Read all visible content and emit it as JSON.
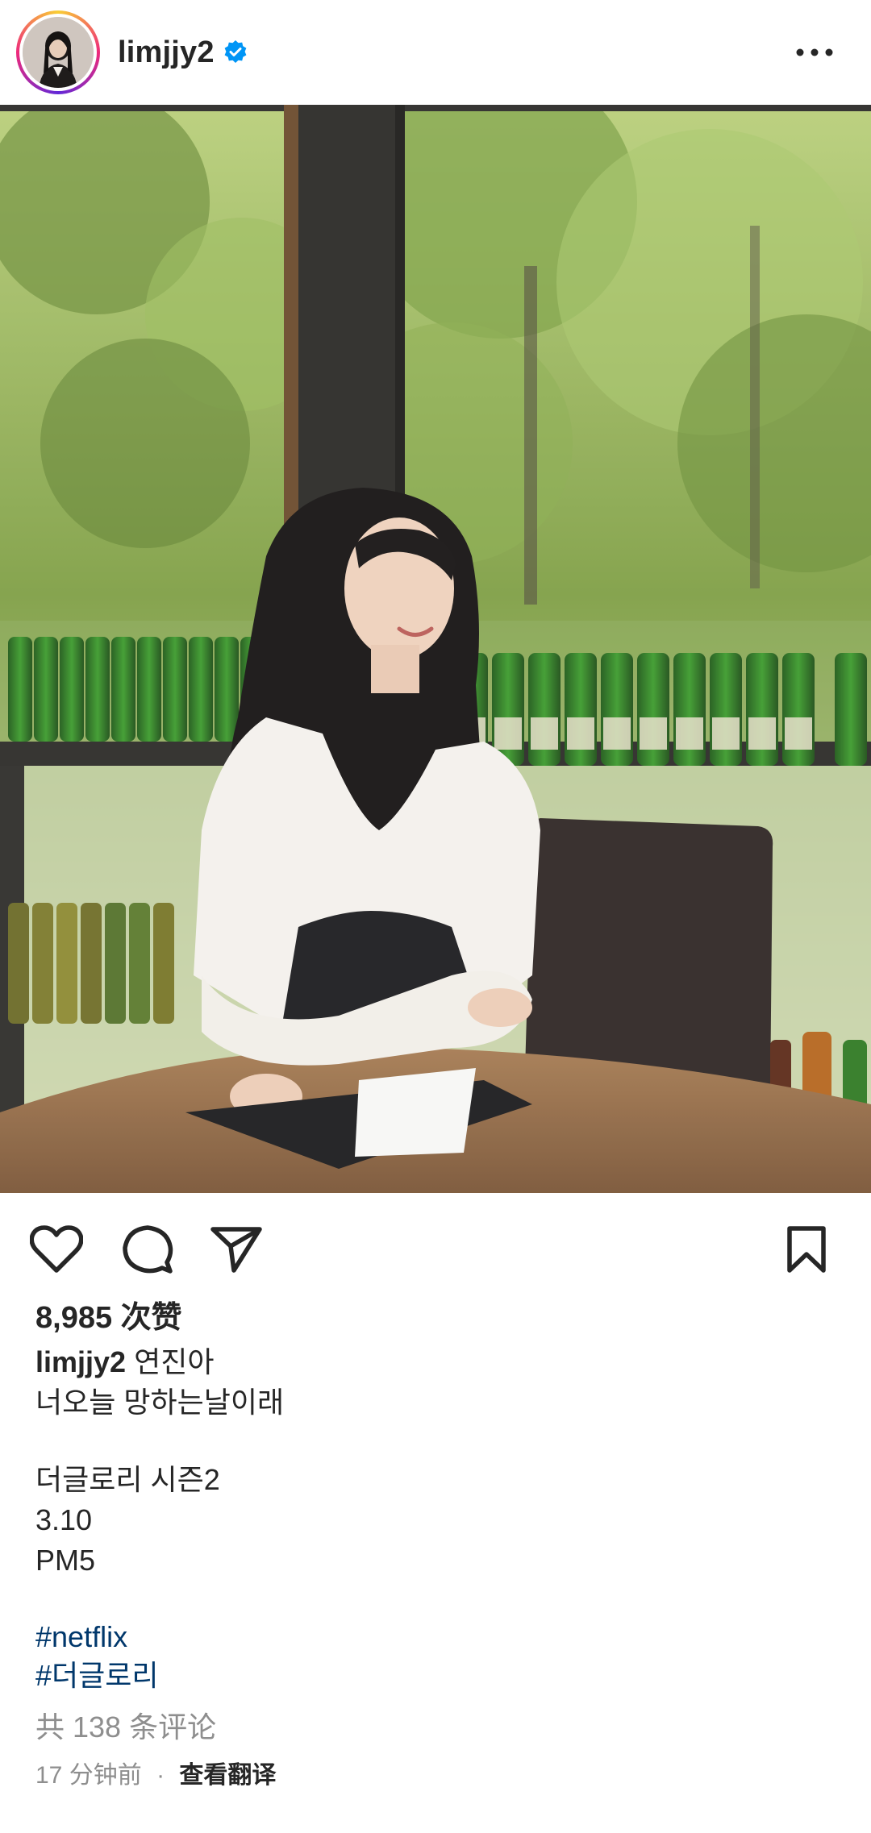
{
  "post": {
    "username": "limjjy2",
    "verified": true,
    "more_icon": "more-horizontal-icon"
  },
  "photo": {
    "alt_icon": "post-photo"
  },
  "actions": {
    "like_icon": "heart-icon",
    "comment_icon": "comment-icon",
    "share_icon": "send-icon",
    "save_icon": "bookmark-icon"
  },
  "likes": "8,985 次赞",
  "caption": {
    "username": "limjjy2",
    "first_line": "연진아",
    "line2": "너오늘 망하는날이래",
    "line3": "더글로리 시즌2",
    "line4": "3.10",
    "line5": "PM5",
    "hashtags": [
      "#netflix",
      "#더글로리"
    ]
  },
  "comments_link": "共 138 条评论",
  "footer": {
    "time": "17 分钟前",
    "separator": "·",
    "translate": "查看翻译"
  },
  "colors": {
    "text": "#262626",
    "secondary": "#8e8e8e",
    "link": "#00376b",
    "verified": "#0095f6"
  }
}
